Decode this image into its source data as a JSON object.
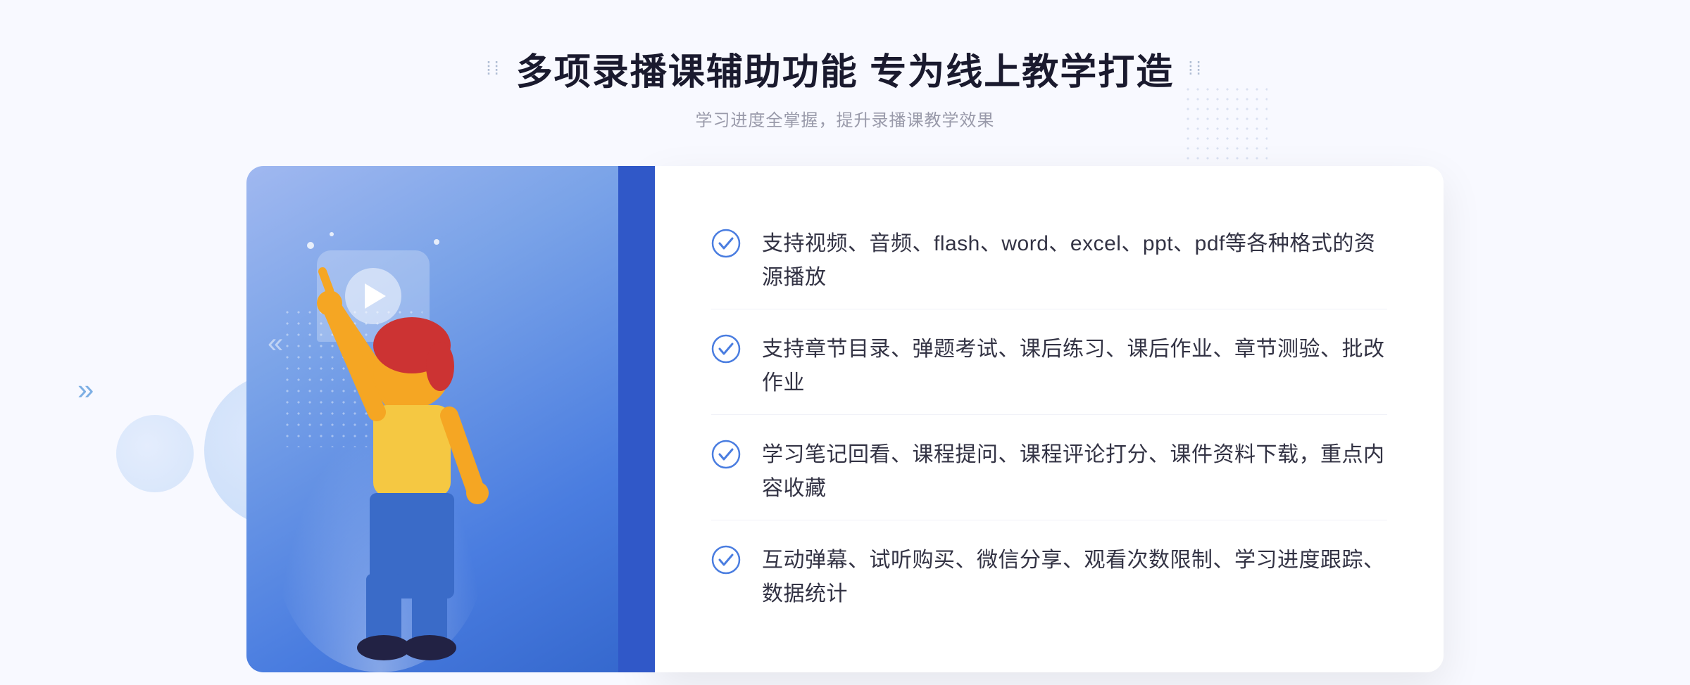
{
  "page": {
    "background": "#f8f9ff"
  },
  "header": {
    "deco_left": "⁞⁞",
    "deco_right": "⁞⁞",
    "title": "多项录播课辅助功能 专为线上教学打造",
    "subtitle": "学习进度全掌握，提升录播课教学效果"
  },
  "features": [
    {
      "id": 1,
      "text": "支持视频、音频、flash、word、excel、ppt、pdf等各种格式的资源播放"
    },
    {
      "id": 2,
      "text": "支持章节目录、弹题考试、课后练习、课后作业、章节测验、批改作业"
    },
    {
      "id": 3,
      "text": "学习笔记回看、课程提问、课程评论打分、课件资料下载，重点内容收藏"
    },
    {
      "id": 4,
      "text": "互动弹幕、试听购买、微信分享、观看次数限制、学习进度跟踪、数据统计"
    }
  ],
  "colors": {
    "accent_blue": "#4a7de0",
    "dark_blue": "#3058c8",
    "check_color": "#4a7de0",
    "title_color": "#1a1a2e",
    "text_color": "#333344",
    "subtitle_color": "#999aaa"
  },
  "illustration": {
    "play_button_alt": "play button"
  }
}
